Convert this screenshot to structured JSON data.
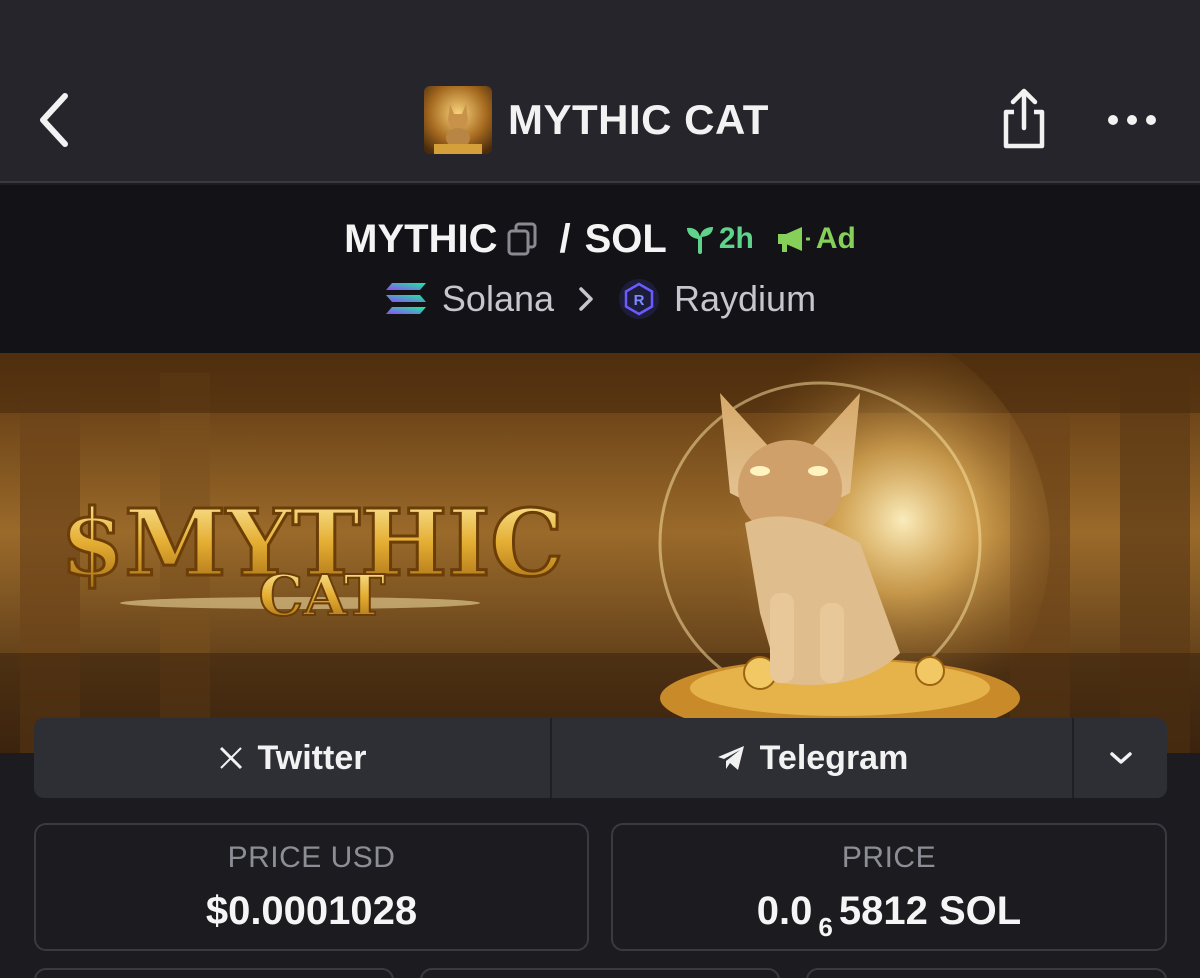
{
  "header": {
    "title": "MYTHIC CAT",
    "back_icon": "chevron-left-icon",
    "share_icon": "share-icon",
    "more_icon": "more-horizontal-icon"
  },
  "pair": {
    "base": "MYTHIC",
    "separator": "/",
    "quote": "SOL",
    "age": "2h",
    "ad_label": "Ad",
    "chain": "Solana",
    "dex": "Raydium"
  },
  "banner": {
    "title_line1": "$MYTHIC",
    "title_line2": "CAT"
  },
  "socials": {
    "twitter_label": "Twitter",
    "telegram_label": "Telegram"
  },
  "stats": {
    "price_usd_label": "PRICE USD",
    "price_usd_value": "$0.0001028",
    "price_label": "PRICE",
    "price_native_prefix": "0.0",
    "price_native_zeros": "6",
    "price_native_digits": "5812",
    "price_native_unit": "SOL"
  },
  "colors": {
    "header_bg": "#26252b",
    "pair_bg": "#121217",
    "page_bg": "#1b1b20",
    "age_green": "#5fd38b",
    "ad_green": "#86d05a",
    "gold": "#e0b040"
  }
}
